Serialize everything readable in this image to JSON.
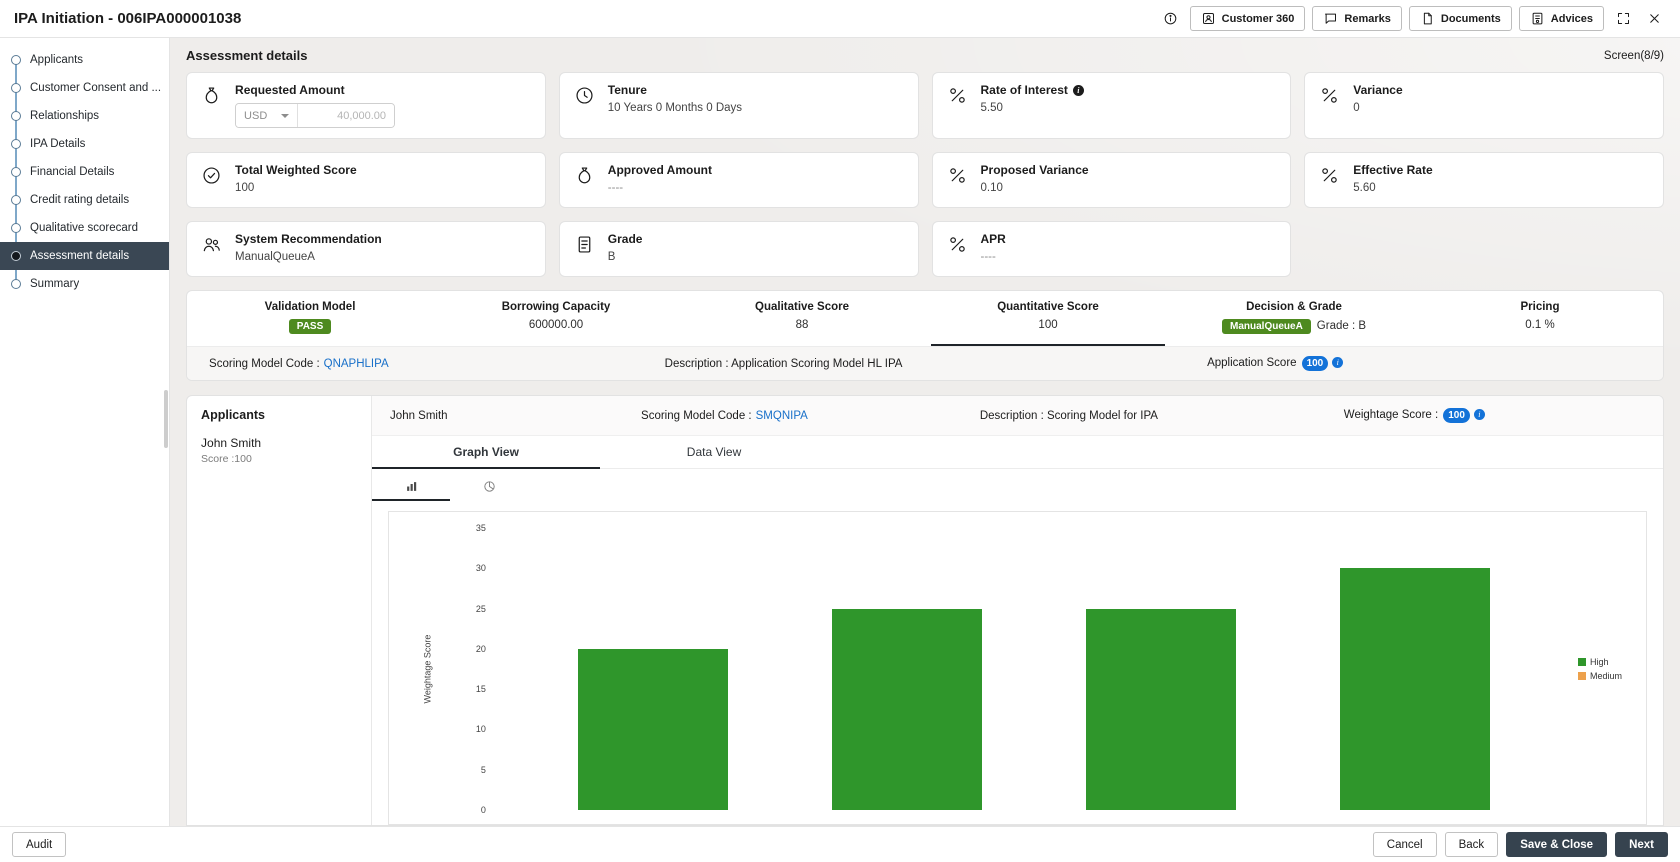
{
  "colors": {
    "badge-green": "#4e8a1f",
    "badge-blue": "#1372d8",
    "link-blue": "#1970c9",
    "bar-green": "#2f962b",
    "legend-orange": "#eda14c",
    "dark-button": "#36434f",
    "active-step": "#3a4754"
  },
  "icons": {
    "info": "circle-i",
    "customer_360": "person-badge",
    "remarks": "speech-bubble",
    "documents": "document",
    "advices": "document-seal",
    "expand": "corner-arrows",
    "close": "✕",
    "chevron_down": "▾",
    "requested_amount": "money-bag",
    "tenure": "clock",
    "rate": "percent",
    "weighted_score": "check-circle",
    "recommendation": "people",
    "grade": "document-lines",
    "bar_chart": "bar-chart",
    "pie_chart": "pie-chart"
  },
  "topbar": {
    "title": "IPA Initiation - 006IPA000001038",
    "actions": [
      {
        "label": "Customer 360"
      },
      {
        "label": "Remarks"
      },
      {
        "label": "Documents"
      },
      {
        "label": "Advices"
      }
    ]
  },
  "sidebar": {
    "items": [
      {
        "label": "Applicants"
      },
      {
        "label": "Customer Consent and ..."
      },
      {
        "label": "Relationships"
      },
      {
        "label": "IPA Details"
      },
      {
        "label": "Financial Details"
      },
      {
        "label": "Credit rating details"
      },
      {
        "label": "Qualitative scorecard"
      },
      {
        "label": "Assessment details"
      },
      {
        "label": "Summary"
      }
    ]
  },
  "main": {
    "title": "Assessment details",
    "screen_indicator": "Screen(8/9)",
    "cards": [
      {
        "label": "Requested Amount",
        "currency": "USD",
        "amount_placeholder": "40,000.00"
      },
      {
        "label": "Tenure",
        "value": "10 Years 0 Months 0 Days"
      },
      {
        "label": "Rate of Interest",
        "value": "5.50"
      },
      {
        "label": "Variance",
        "value": "0"
      },
      {
        "label": "Total Weighted Score",
        "value": "100"
      },
      {
        "label": "Approved Amount",
        "value": "----"
      },
      {
        "label": "Proposed Variance",
        "value": "0.10"
      },
      {
        "label": "Effective Rate",
        "value": "5.60"
      },
      {
        "label": "System Recommendation",
        "value": "ManualQueueA"
      },
      {
        "label": "Grade",
        "value": "B"
      },
      {
        "label": "APR",
        "value": "----"
      }
    ],
    "summary": {
      "columns": [
        {
          "label": "Validation Model",
          "badge": "PASS"
        },
        {
          "label": "Borrowing Capacity",
          "value": "600000.00"
        },
        {
          "label": "Qualitative Score",
          "value": "88"
        },
        {
          "label": "Quantitative Score",
          "value": "100"
        },
        {
          "label": "Decision & Grade",
          "badge": "ManualQueueA",
          "suffix": "Grade : B"
        },
        {
          "label": "Pricing",
          "value": "0.1 %"
        }
      ]
    },
    "scoring": {
      "model_code_label": "Scoring Model Code :",
      "model_code": "QNAPHLIPA",
      "description": "Description : Application Scoring Model HL IPA",
      "application_score_label": "Application Score",
      "application_score": "100"
    },
    "applicants_panel": {
      "title": "Applicants",
      "items": [
        {
          "name": "John Smith",
          "score": "Score :100"
        }
      ]
    },
    "applicant_detail": {
      "name": "John Smith",
      "model_code_label": "Scoring Model Code :",
      "model_code": "SMQNIPA",
      "description": "Description : Scoring Model for IPA",
      "weightage_label": "Weightage Score :",
      "weightage_score": "100",
      "tabs": [
        {
          "label": "Graph View"
        },
        {
          "label": "Data View"
        }
      ]
    }
  },
  "chart_data": {
    "type": "bar",
    "values": [
      20,
      25,
      25,
      30
    ],
    "ylabel": "Weightage Score",
    "ylim": [
      0,
      35
    ],
    "yticks": [
      0,
      5,
      10,
      15,
      20,
      25,
      30,
      35
    ],
    "bar_color": "#2f962b",
    "grid": false,
    "legend_position": "right",
    "legend": [
      {
        "label": "High",
        "color": "#2f962b"
      },
      {
        "label": "Medium",
        "color": "#eda14c"
      }
    ]
  },
  "footer": {
    "audit": "Audit",
    "cancel": "Cancel",
    "back": "Back",
    "save_close": "Save & Close",
    "next": "Next"
  }
}
